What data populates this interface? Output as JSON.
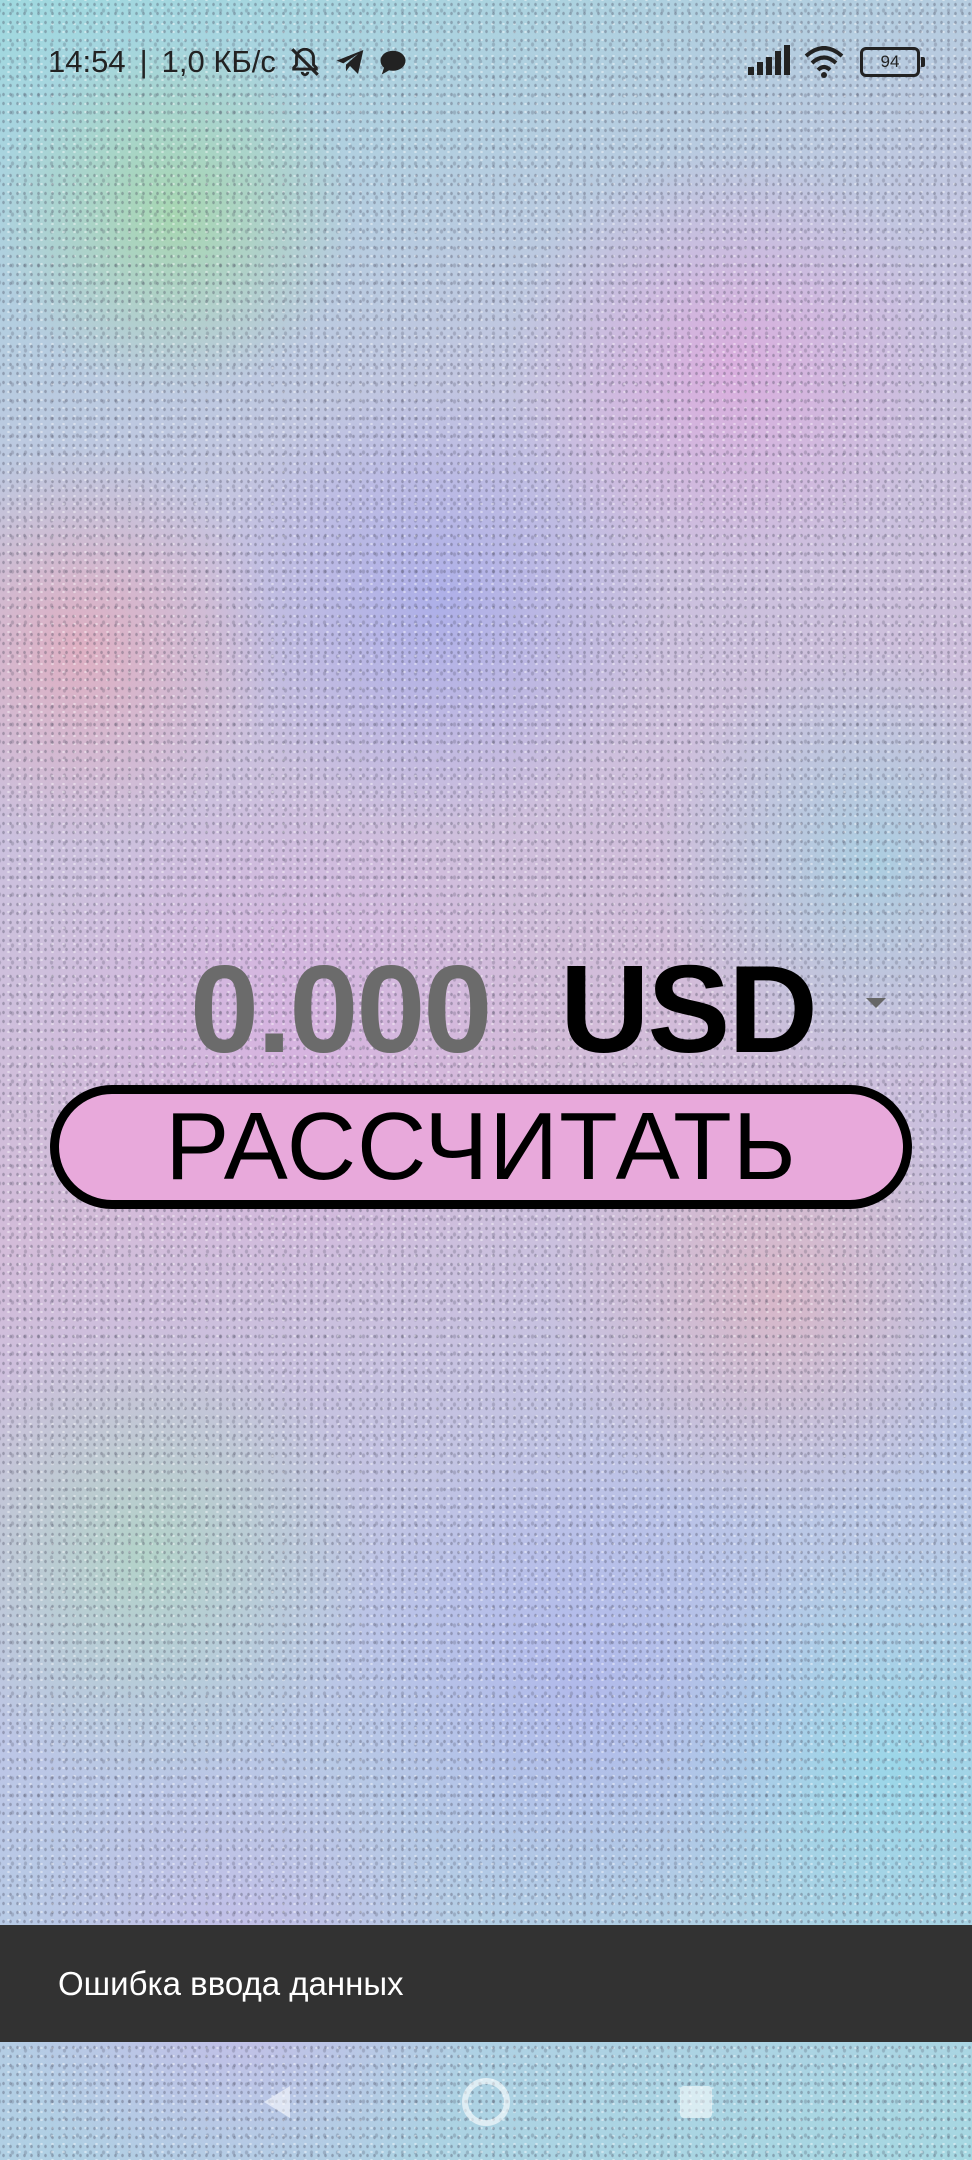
{
  "status_bar": {
    "time": "14:54",
    "separator": "|",
    "net_speed": "1,0 КБ/с",
    "battery_level": "94",
    "icons": [
      "notifications-off-icon",
      "telegram-icon",
      "chat-bubble-icon",
      "signal-icon",
      "wifi-icon",
      "battery-icon"
    ]
  },
  "converter": {
    "amount": "0.000",
    "currency": "USD",
    "calculate_label": "РАССЧИТАТЬ"
  },
  "snackbar": {
    "message": "Ошибка ввода данных"
  },
  "nav_bar": {
    "icons": [
      "back-icon",
      "home-icon",
      "recents-icon"
    ]
  },
  "colors": {
    "button_fill": "#e8a9db",
    "button_border": "#000000",
    "amount_text": "#6b6b6b",
    "snackbar_bg": "#323232"
  }
}
